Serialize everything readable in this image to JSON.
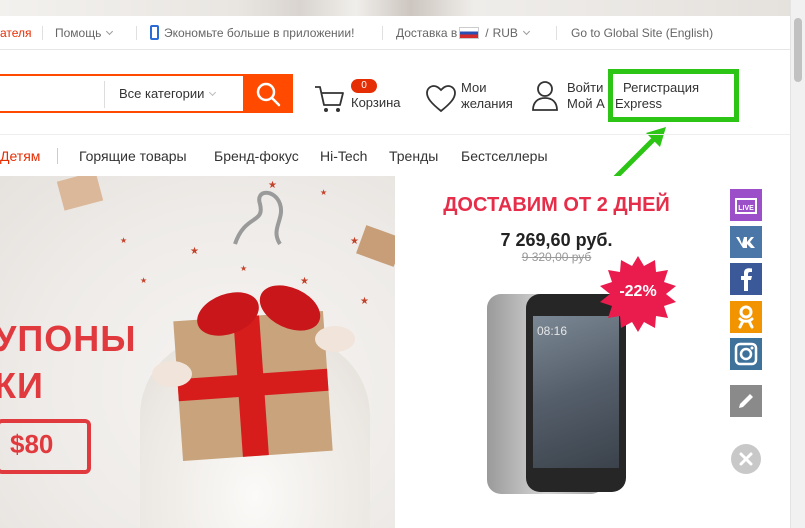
{
  "topbar": {
    "seller_partial": "ателя",
    "help": "Помощь",
    "app_promo": "Экономьте больше в приложении!",
    "delivery_to": "Доставка в",
    "currency": "RUB",
    "global_site": "Go to Global Site (English)"
  },
  "header": {
    "search_placeholder": "",
    "categories": "Все категории",
    "cart_count": "0",
    "cart_label": "Корзина",
    "wishlist_line1": "Мои",
    "wishlist_line2": "желания",
    "login_line1": "Войти",
    "login_line2": "Мой A",
    "register_line1": "Регистрация",
    "register_line2": "Express"
  },
  "nav": {
    "partial_item": "Детям",
    "items": [
      "Горящие товары",
      "Бренд-фокус",
      "Hi-Tech",
      "Тренды",
      "Бестселлеры"
    ]
  },
  "banner": {
    "line1_partial": "УПОНЫ",
    "line2_partial": "КИ",
    "coupon_value": "$80"
  },
  "promo": {
    "title": "ДОСТАВИМ ОТ 2 ДНЕЙ",
    "price": "7 269,60 руб.",
    "old_price": "9 320,00   руб",
    "discount": "-22%",
    "screen_time": "08:16"
  },
  "social": [
    "live-icon",
    "vk-icon",
    "facebook-icon",
    "ok-icon",
    "instagram-icon",
    "edit-icon",
    "close-icon"
  ],
  "colors": {
    "accent": "#ff4a00",
    "promo_red": "#e62e4a",
    "highlight_green": "#2cc516",
    "live_purple": "#9b4fc9",
    "vk_blue": "#4a76a8",
    "fb_blue": "#3b5998",
    "ok_orange": "#f29400",
    "insta_blue": "#3f729b"
  }
}
